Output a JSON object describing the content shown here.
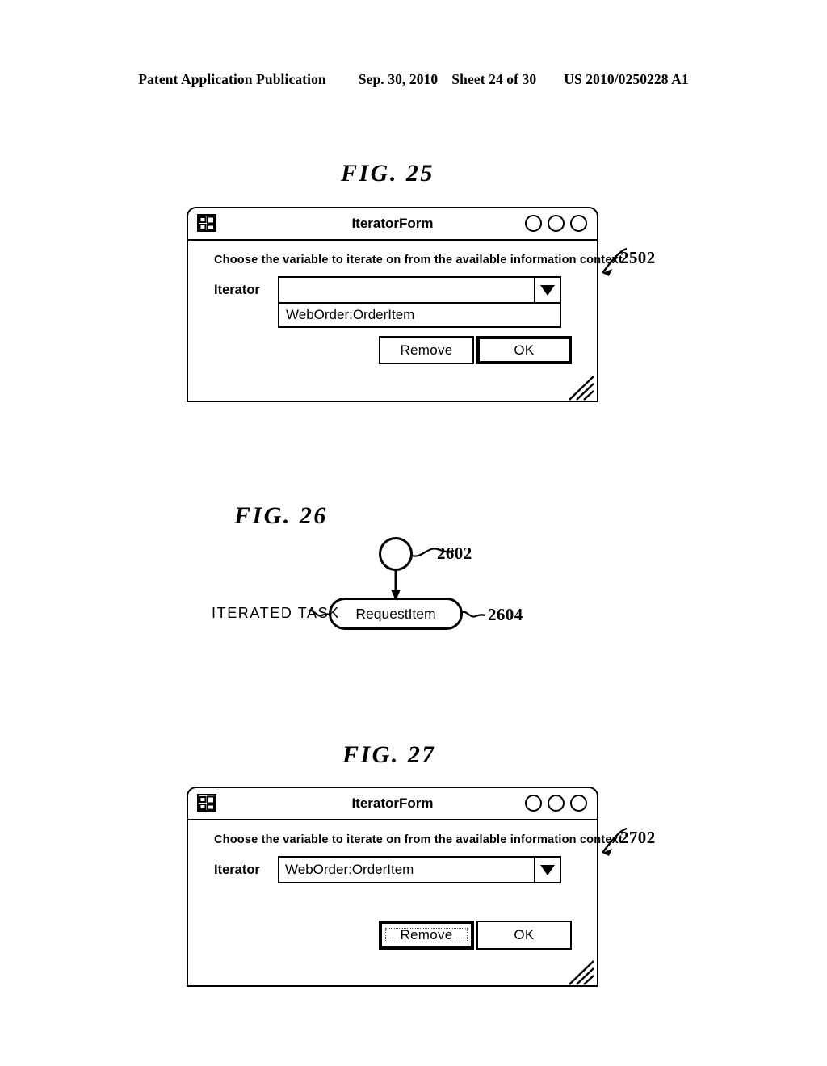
{
  "header": {
    "publication": "Patent Application Publication",
    "date": "Sep. 30, 2010",
    "sheet": "Sheet 24 of 30",
    "patent_number": "US 2010/0250228 A1"
  },
  "figures": [
    {
      "caption": "FIG.  25",
      "callout": "2502",
      "dialog": {
        "title": "IteratorForm",
        "icon": "window-tile-icon",
        "window_controls": [
          "minimize-circle",
          "maximize-circle",
          "close-circle"
        ],
        "prompt": "Choose the variable to iterate on from the available information context.",
        "field_label": "Iterator",
        "combo_value": "",
        "combo_arrow": "chevron-down-icon",
        "dropdown_open": true,
        "dropdown_options": [
          "WebOrder:OrderItem"
        ],
        "buttons": [
          {
            "label": "Remove",
            "state": "normal"
          },
          {
            "label": "OK",
            "state": "default"
          }
        ],
        "resize_grip": "resize-grip-icon"
      }
    },
    {
      "caption": "FIG.  26",
      "diagram": {
        "side_label": "ITERATED TASK",
        "start_node": {
          "shape": "circle",
          "callout": "2602"
        },
        "task_node": {
          "label": "RequestItem",
          "shape": "rounded-rect",
          "callout": "2604"
        },
        "connector": "arrow-down"
      }
    },
    {
      "caption": "FIG.  27",
      "callout": "2702",
      "dialog": {
        "title": "IteratorForm",
        "icon": "window-tile-icon",
        "window_controls": [
          "minimize-circle",
          "maximize-circle",
          "close-circle"
        ],
        "prompt": "Choose the variable to iterate on from the available information context.",
        "field_label": "Iterator",
        "combo_value": "WebOrder:OrderItem",
        "combo_arrow": "chevron-down-icon",
        "dropdown_open": false,
        "dropdown_options": [],
        "buttons": [
          {
            "label": "Remove",
            "state": "focused"
          },
          {
            "label": "OK",
            "state": "normal"
          }
        ],
        "resize_grip": "resize-grip-icon"
      }
    }
  ]
}
